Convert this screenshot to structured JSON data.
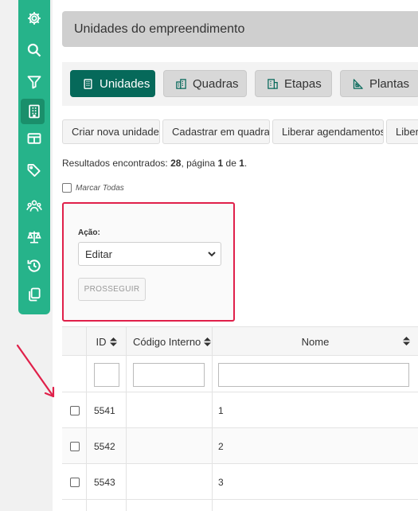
{
  "sidebar": {
    "items": [
      {
        "icon": "gear-icon"
      },
      {
        "icon": "search-icon"
      },
      {
        "icon": "filter-icon"
      },
      {
        "icon": "building-icon",
        "active": true
      },
      {
        "icon": "table-icon"
      },
      {
        "icon": "tag-icon"
      },
      {
        "icon": "users-icon"
      },
      {
        "icon": "scale-icon"
      },
      {
        "icon": "history-icon"
      },
      {
        "icon": "copy-icon"
      }
    ],
    "color": "#26b38a",
    "active_color": "#1a8f6b"
  },
  "header": {
    "title": "Unidades do empreendimento"
  },
  "tabs": [
    {
      "label": "Unidades",
      "icon": "building-icon",
      "active": true
    },
    {
      "label": "Quadras",
      "icon": "buildings-icon"
    },
    {
      "label": "Etapas",
      "icon": "office-building-icon"
    },
    {
      "label": "Plantas",
      "icon": "set-square-icon"
    }
  ],
  "actions": [
    {
      "label": "Criar nova unidade"
    },
    {
      "label": "Cadastrar em quadra"
    },
    {
      "label": "Liberar agendamentos"
    },
    {
      "label": "Libera"
    }
  ],
  "results": {
    "prefix": "Resultados encontrados:",
    "count": "28",
    "page_word": ", página",
    "page": "1",
    "of_word": "de",
    "total_pages": "1",
    "suffix": "."
  },
  "mark_all": {
    "label": "Marcar Todas"
  },
  "action_box": {
    "label": "Ação:",
    "selected": "Editar",
    "proceed_label": "PROSSEGUIR"
  },
  "table": {
    "columns": [
      {
        "label": "ID"
      },
      {
        "label": "Código Interno"
      },
      {
        "label": "Nome"
      }
    ],
    "rows": [
      {
        "id": "5541",
        "codigo": "",
        "nome": "1"
      },
      {
        "id": "5542",
        "codigo": "",
        "nome": "2"
      },
      {
        "id": "5543",
        "codigo": "",
        "nome": "3"
      }
    ]
  },
  "colors": {
    "accent": "#06695a",
    "highlight": "#e0204a"
  }
}
